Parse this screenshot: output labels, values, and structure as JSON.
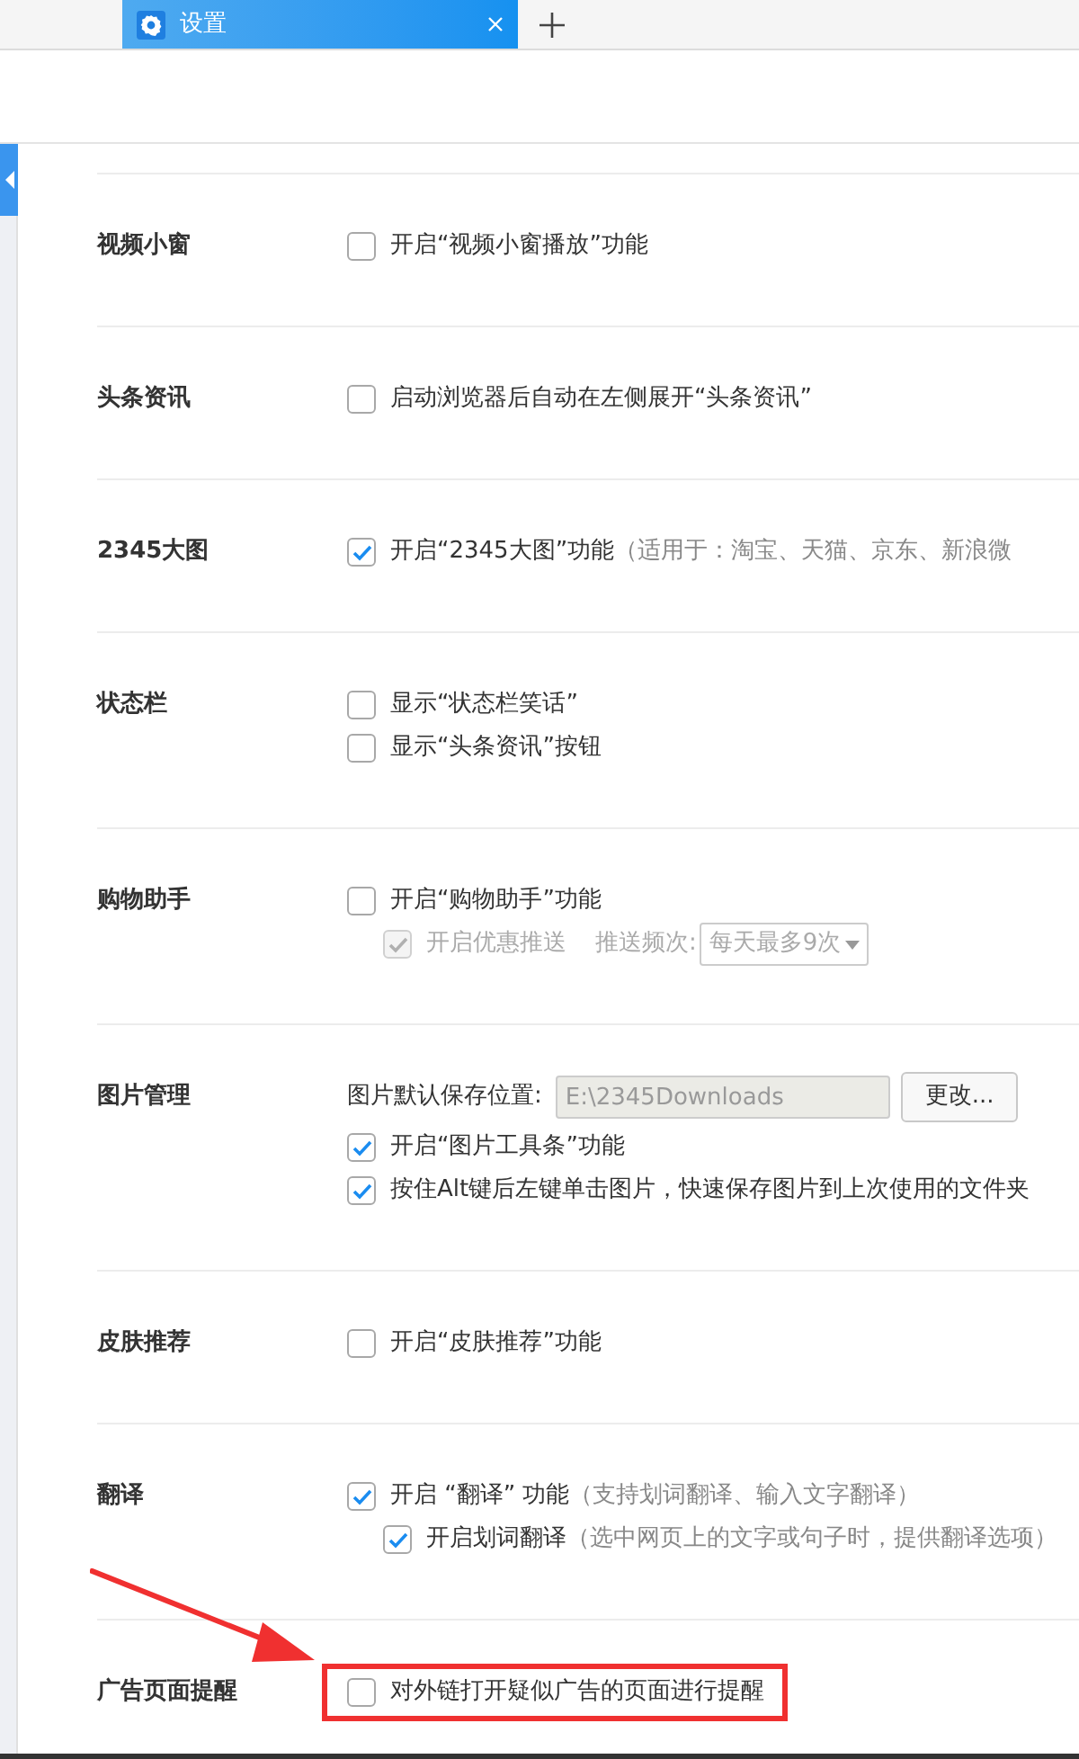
{
  "tabs": [
    {
      "title": "设置",
      "selected": true
    }
  ],
  "sections": [
    {
      "label": "视频小窗",
      "options": [
        {
          "kind": "checkbox",
          "text": "开启“视频小窗播放”功能",
          "checked": false
        }
      ]
    },
    {
      "label": "头条资讯",
      "options": [
        {
          "kind": "checkbox",
          "text": "启动浏览器后自动在左侧展开“头条资讯”",
          "checked": false
        }
      ]
    },
    {
      "label": "2345大图",
      "options": [
        {
          "kind": "checkbox",
          "text": "开启“2345大图”功能",
          "note": "（适用于：淘宝、天猫、京东、新浪微",
          "checked": true
        }
      ]
    },
    {
      "label": "状态栏",
      "options": [
        {
          "kind": "checkbox",
          "text": "显示“状态栏笑话”",
          "checked": false
        },
        {
          "kind": "checkbox",
          "text": "显示“头条资讯”按钮",
          "checked": false
        }
      ]
    },
    {
      "label": "购物助手",
      "options": [
        {
          "kind": "checkbox",
          "text": "开启“购物助手”功能",
          "checked": false,
          "children": [
            {
              "kind": "checkbox",
              "text": "开启优惠推送",
              "checked": true,
              "disabled": true,
              "extra_label": "推送频次:",
              "dropdown": "每天最多9次"
            }
          ]
        }
      ]
    },
    {
      "label": "图片管理",
      "options": [
        {
          "kind": "path",
          "text": "图片默认保存位置:",
          "value": "E:\\2345Downloads",
          "button": "更改..."
        },
        {
          "kind": "checkbox",
          "text": "开启“图片工具条”功能",
          "checked": true
        },
        {
          "kind": "checkbox",
          "text": "按住Alt键后左键单击图片，快速保存图片到上次使用的文件夹",
          "checked": true
        }
      ]
    },
    {
      "label": "皮肤推荐",
      "options": [
        {
          "kind": "checkbox",
          "text": "开启“皮肤推荐”功能",
          "checked": false
        }
      ]
    },
    {
      "label": "翻译",
      "options": [
        {
          "kind": "checkbox",
          "text": "开启 “翻译” 功能",
          "note": "（支持划词翻译、输入文字翻译）",
          "checked": true,
          "children": [
            {
              "kind": "checkbox",
              "text": "开启划词翻译",
              "note": "（选中网页上的文字或句子时，提供翻译选项）",
              "checked": true,
              "disabled": false
            }
          ]
        }
      ]
    },
    {
      "label": "广告页面提醒",
      "options": [
        {
          "kind": "checkbox",
          "text": "对外链打开疑似广告的页面进行提醒",
          "checked": false,
          "highlighted": true
        }
      ]
    }
  ]
}
